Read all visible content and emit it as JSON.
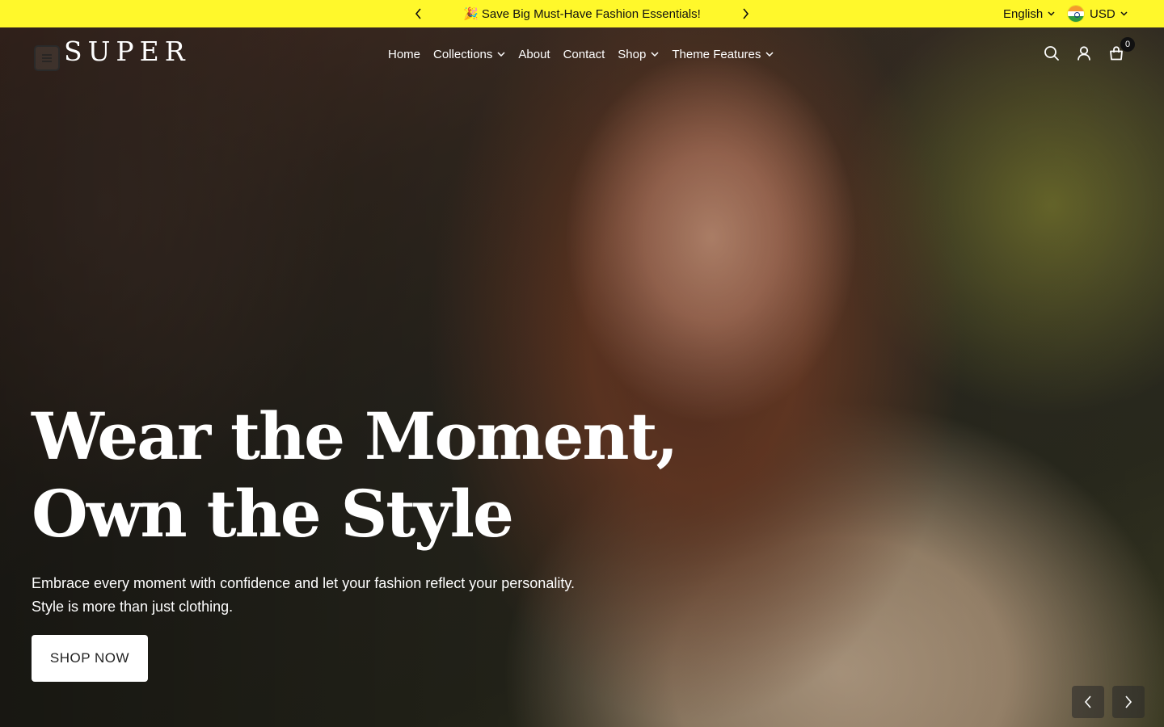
{
  "announcement": {
    "emoji": "🎉",
    "message": "Save Big Must-Have Fashion Essentials!",
    "prev_icon": "chevron-left-icon",
    "next_icon": "chevron-right-icon"
  },
  "locale": {
    "language": "English",
    "currency": "USD",
    "flag": "india-flag-icon"
  },
  "colors": {
    "announcement_bg": "#fff82b",
    "button_bg": "#ffffff",
    "text_light": "#ffffff"
  },
  "header": {
    "logo": "SUPER",
    "nav": [
      {
        "label": "Home",
        "dropdown": false
      },
      {
        "label": "Collections",
        "dropdown": true
      },
      {
        "label": "About",
        "dropdown": false
      },
      {
        "label": "Contact",
        "dropdown": false
      },
      {
        "label": "Shop",
        "dropdown": true
      },
      {
        "label": "Theme Features",
        "dropdown": true
      }
    ],
    "cart_count": "0",
    "icons": [
      "menu-icon",
      "search-icon",
      "account-icon",
      "cart-icon"
    ]
  },
  "hero": {
    "headline_line1": "Wear the Moment,",
    "headline_line2": "Own the Style",
    "subtext_line1": "Embrace every moment with confidence and let your fashion reflect your personality.",
    "subtext_line2": "Style is more than just clothing.",
    "cta": "SHOP NOW"
  }
}
